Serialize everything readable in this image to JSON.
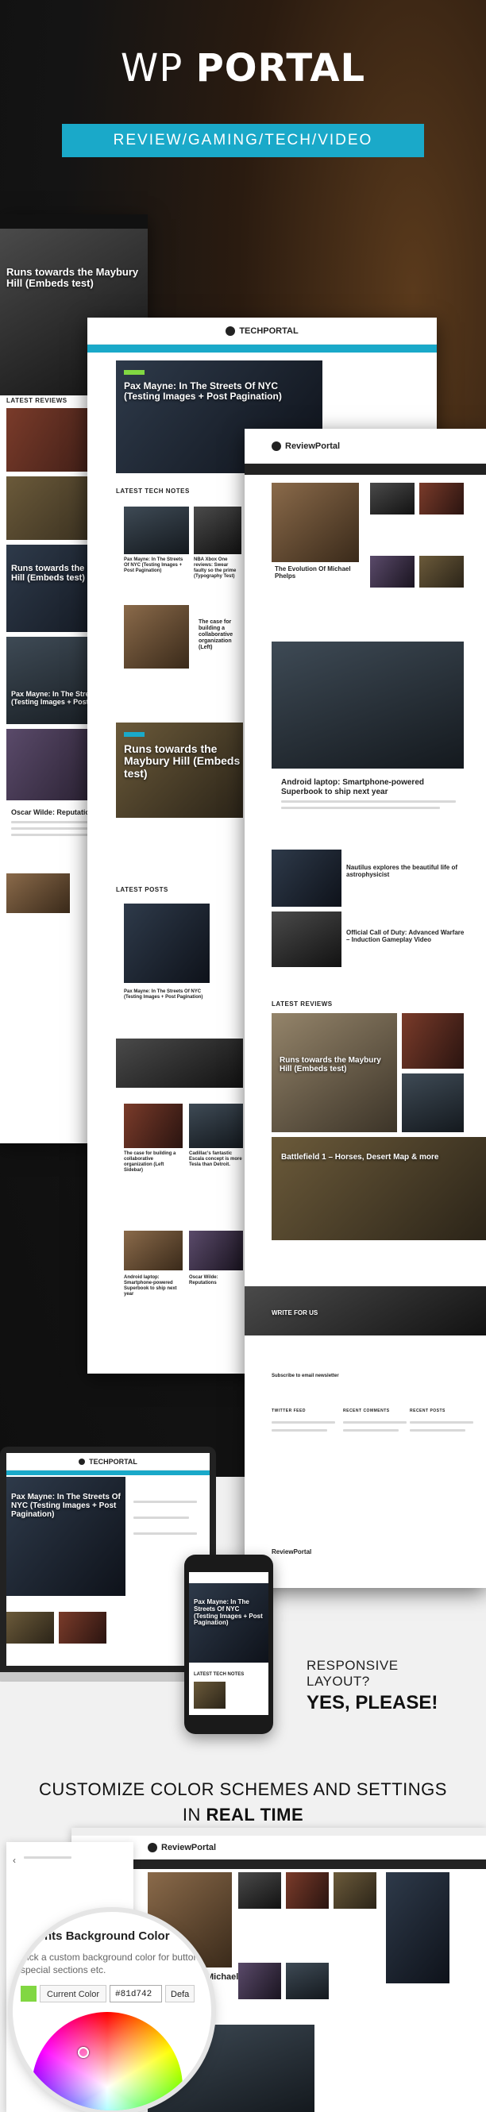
{
  "hero": {
    "title_light": "WP",
    "title_bold": "PORTAL",
    "categories": "REVIEW/GAMING/TECH/VIDEO"
  },
  "screen_left": {
    "headline": "Runs towards the Maybury Hill (Embeds test)",
    "section": "LATEST REVIEWS",
    "card1": "Runs towards the Maybury Hill (Embeds test)",
    "card2": "Pax Mayne: In The Streets Of NYC (Testing Images + Post Pagination)",
    "card3": "Oscar Wilde: Reputations"
  },
  "screen_tech": {
    "logo": "TECHPORTAL",
    "headline": "Pax Mayne: In The Streets Of NYC (Testing Images + Post Pagination)",
    "section1": "LATEST TECH NOTES",
    "note1": "Pax Mayne: In The Streets Of NYC (Testing Images + Post Pagination)",
    "note2": "NBA Xbox One reviews: Swear faulty so the prime (Typography Test)",
    "note3": "The case for building a collaborative organization (Left)",
    "feature": "Runs towards the Maybury Hill (Embeds test)",
    "section2": "LATEST POSTS",
    "post1": "Pax Mayne: In The Streets Of NYC (Testing Images + Post Pagination)",
    "post2": "The case for building a collaborative organization (Left Sidebar)",
    "post3": "Cadillac's fantastic Escala concept is more Tesla than Detroit.",
    "post4": "Android laptop: Smartphone-powered Superbook to ship next year",
    "post5": "Oscar Wilde: Reputations"
  },
  "screen_review": {
    "logo": "ReviewPortal",
    "story1": "The Evolution Of Michael Phelps",
    "story2": "Android laptop: Smartphone-powered Superbook to ship next year",
    "story3": "Nautilus explores the beautiful life of astrophysicist",
    "story4": "Official Call of Duty: Advanced Warfare – Induction Gameplay Video",
    "section1": "LATEST REVIEWS",
    "review1": "Runs towards the Maybury Hill (Embeds test)",
    "review2": "Battlefield 1 – Horses, Desert Map & more",
    "write_for_us": "WRITE FOR US",
    "subscribe": "Subscribe to email newsletter",
    "col1": "TWITTER FEED",
    "col2": "RECENT COMMENTS",
    "col3": "RECENT POSTS",
    "footer_logo": "ReviewPortal"
  },
  "laptop": {
    "logo": "TECHPORTAL",
    "headline": "Pax Mayne: In The Streets Of NYC (Testing Images + Post Pagination)"
  },
  "phone": {
    "headline": "Pax Mayne: In The Streets Of NYC (Testing Images + Post Pagination)",
    "section": "LATEST TECH NOTES"
  },
  "responsive": {
    "line1": "RESPONSIVE LAYOUT?",
    "line2": "YES, PLEASE!"
  },
  "customize": {
    "line1": "CUSTOMIZE COLOR SCHEMES AND SETTINGS",
    "line2_light": "IN",
    "line2_bold": "REAL TIME"
  },
  "customizer": {
    "title": "ements Background Color",
    "desc": "Pick a custom background color for buttons, special sections etc.",
    "current_label": "Current Color",
    "hex_value": "#81d742",
    "default_label": "Defa",
    "accent": "#81d742"
  },
  "bottom_shot": {
    "logo": "ReviewPortal",
    "headline": "Michael"
  }
}
